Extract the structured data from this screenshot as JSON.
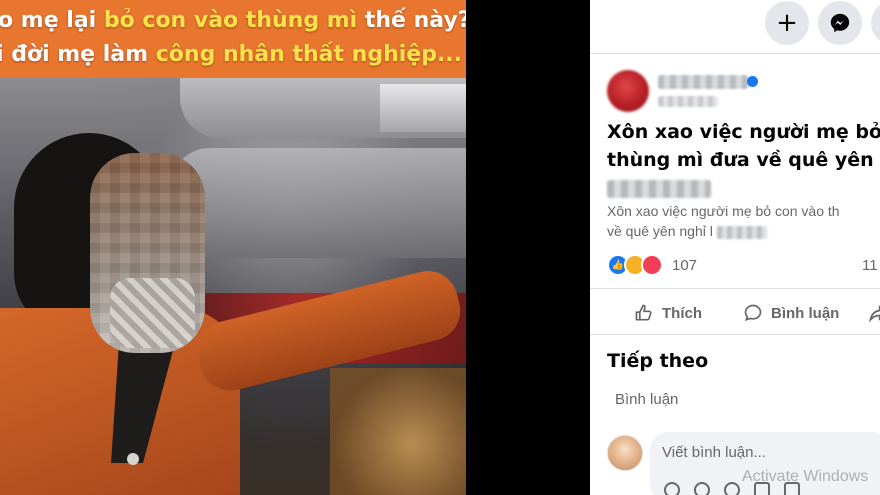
{
  "video": {
    "caption_line1_pre": "o mẹ lại ",
    "caption_line1_hl": "bỏ con vào thùng mì",
    "caption_line1_post": " thế này?",
    "caption_line2_pre": "i đời mẹ làm ",
    "caption_line2_hl": "công nhân thất nghiệp...",
    "caption_bg_color": "#e9762f",
    "highlight_color": "#ffe24a"
  },
  "header": {
    "icons": [
      "plus-icon",
      "messenger-icon",
      "profile-icon"
    ]
  },
  "post": {
    "title_line1": "Xôn xao việc người mẹ bỏ",
    "title_line2": "thùng mì đưa về quê yên n",
    "description_line1": "Xôn xao việc người mẹ bỏ con vào th",
    "description_line2": "về quê yên nghỉ l",
    "reaction_icons": [
      "like-reaction",
      "sad-reaction",
      "care-reaction"
    ],
    "reaction_count": "107",
    "comment_count": "11",
    "actions": {
      "like": "Thích",
      "comment": "Bình luận"
    }
  },
  "next_section": {
    "title": "Tiếp theo",
    "subtitle": "Bình luận"
  },
  "comment_input": {
    "placeholder": "Viết bình luận..."
  },
  "watermark": {
    "text": "Activate Windows"
  },
  "colors": {
    "accent": "#1877f2",
    "muted_text": "#65676b"
  }
}
